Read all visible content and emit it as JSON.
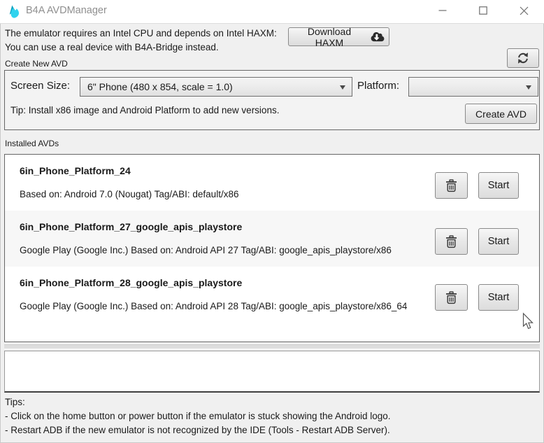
{
  "window": {
    "title": "B4A AVDManager"
  },
  "icons": {
    "logo": "b4a-flame",
    "minimize": "minimize-dash",
    "maximize": "maximize-square",
    "close": "close-x",
    "download": "cloud-download",
    "refresh": "sync-arrows",
    "delete": "trash-can",
    "combo_caret": "chevron-down",
    "cursor": "mouse-arrow"
  },
  "colors": {
    "brand_teal_dark": "#0aa2c0",
    "brand_teal_light": "#30d3ee",
    "window_bg": "#f0f0f0",
    "titlebar_bg": "#ffffff",
    "title_text": "#8f8f8f",
    "text": "#1a1a1a",
    "button_border": "#8a8a8a",
    "row_alt_bg": "#f7f7f7"
  },
  "header": {
    "line1": "The emulator requires an Intel CPU and depends on Intel HAXM:",
    "line2": "You can use a real device with B4A-Bridge instead.",
    "download_button_label": "Download HAXM"
  },
  "create_avd": {
    "group_label": "Create New AVD",
    "screen_size_label": "Screen Size:",
    "screen_size_value": "6\" Phone (480 x 854, scale = 1.0)",
    "platform_label": "Platform:",
    "platform_value": "",
    "tip": "Tip: Install x86 image and Android Platform to add new versions.",
    "create_button_label": "Create AVD"
  },
  "installed": {
    "group_label": "Installed AVDs",
    "start_label": "Start",
    "avds": [
      {
        "name": "6in_Phone_Platform_24",
        "description": "Based on: Android 7.0 (Nougat) Tag/ABI: default/x86"
      },
      {
        "name": "6in_Phone_Platform_27_google_apis_playstore",
        "description": "Google Play (Google Inc.) Based on: Android API 27 Tag/ABI: google_apis_playstore/x86"
      },
      {
        "name": "6in_Phone_Platform_28_google_apis_playstore",
        "description": "Google Play (Google Inc.) Based on: Android API 28 Tag/ABI: google_apis_playstore/x86_64"
      }
    ]
  },
  "log_area": {
    "value": ""
  },
  "tips": {
    "title": "Tips:",
    "items": [
      "- Click on the home button or power button if the emulator is stuck showing the Android logo.",
      "- Restart ADB if the new emulator is not recognized by the IDE (Tools - Restart ADB Server)."
    ]
  }
}
